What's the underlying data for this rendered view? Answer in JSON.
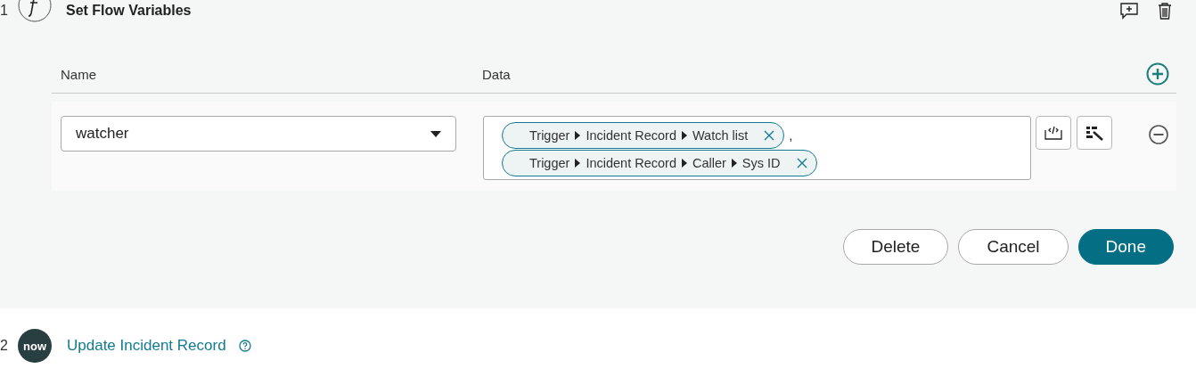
{
  "step_1": {
    "number": "1",
    "title": "Set Flow Variables"
  },
  "variables_table": {
    "columns": [
      "Name",
      "Data"
    ],
    "rows": [
      {
        "name": "watcher",
        "data_pills": [
          {
            "segments": [
              "Trigger",
              "Incident Record",
              "Watch list"
            ],
            "separator": ","
          },
          {
            "segments": [
              "Trigger",
              "Incident Record",
              "Caller",
              "Sys ID"
            ]
          }
        ]
      }
    ]
  },
  "buttons": [
    {
      "label": "Delete",
      "kind": "secondary"
    },
    {
      "label": "Cancel",
      "kind": "secondary"
    },
    {
      "label": "Done",
      "kind": "primary"
    }
  ],
  "step_2": {
    "number": "2",
    "logo": "now",
    "title": "Update Incident Record"
  }
}
